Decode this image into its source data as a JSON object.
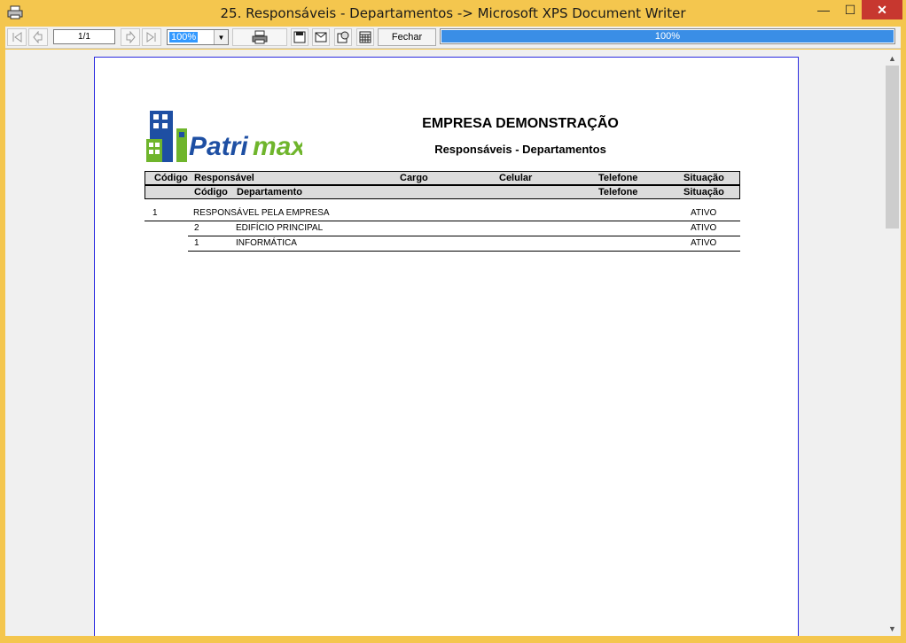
{
  "window": {
    "title": "25. Responsáveis - Departamentos -> Microsoft XPS Document Writer",
    "minimize_glyph": "—",
    "maximize_glyph": "☐",
    "close_glyph": "✕"
  },
  "toolbar": {
    "page_value": "1/1",
    "zoom_value": "100%",
    "close_label": "Fechar",
    "progress_text": "100%",
    "progress_fraction": 1.0,
    "icons": [
      "first-page-icon",
      "previous-page-icon",
      "next-page-icon",
      "last-page-icon",
      "print-icon",
      "save-icon",
      "email-icon",
      "export-icon",
      "setup-icon"
    ]
  },
  "report": {
    "logo_text": "Patrimax",
    "company": "EMPRESA DEMONSTRAÇÃO",
    "title": "Responsáveis - Departamentos",
    "header1": {
      "codigo": "Código",
      "responsavel": "Responsável",
      "cargo": "Cargo",
      "celular": "Celular",
      "telefone": "Telefone",
      "situacao": "Situação"
    },
    "header2": {
      "codigo": "Código",
      "departamento": "Departamento",
      "telefone": "Telefone",
      "situacao": "Situação"
    },
    "responsible": {
      "codigo": "1",
      "nome": "RESPONSÁVEL PELA EMPRESA",
      "situacao": "ATIVO"
    },
    "departments": [
      {
        "codigo": "2",
        "nome": "EDIFÍCIO PRINCIPAL",
        "situacao": "ATIVO"
      },
      {
        "codigo": "1",
        "nome": "INFORMÁTICA",
        "situacao": "ATIVO"
      }
    ]
  },
  "colors": {
    "frame": "#f4c64e",
    "paper_border": "#2a2adf",
    "logo_blue": "#1e4fa3",
    "logo_green": "#6fb52c",
    "progress": "#3a8ee6"
  }
}
